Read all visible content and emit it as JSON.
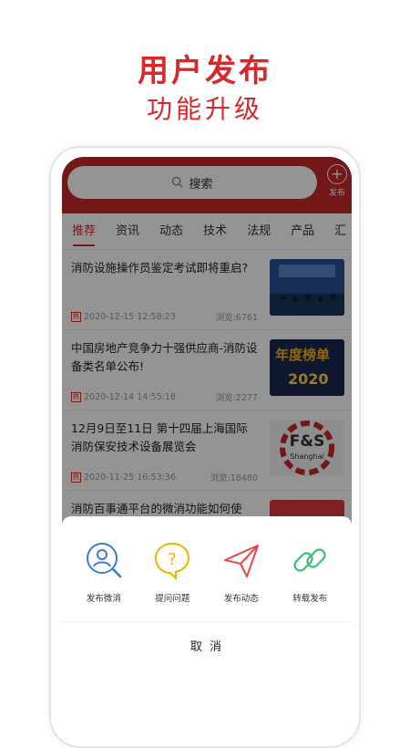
{
  "promo": {
    "title": "用户发布",
    "subtitle": "功能升级"
  },
  "header": {
    "search_placeholder": "搜索",
    "publish_label": "发布",
    "accent_color": "#c9292c"
  },
  "tabs": [
    {
      "label": "推荐",
      "active": true
    },
    {
      "label": "资讯",
      "active": false
    },
    {
      "label": "动态",
      "active": false
    },
    {
      "label": "技术",
      "active": false
    },
    {
      "label": "法规",
      "active": false
    },
    {
      "label": "产品",
      "active": false
    },
    {
      "label": "汇",
      "active": false
    }
  ],
  "news": [
    {
      "title": "消防设施操作员鉴定考试即将重启?",
      "date": "2020-12-15 12:58:23",
      "views": "浏览:6761",
      "badge": "热"
    },
    {
      "title": "中国房地产竞争力十强供应商-消防设备类名单公布!",
      "date": "2020-12-14 14:55:18",
      "views": "浏览:2277",
      "badge": "热",
      "thumb_text": "年度榜单",
      "thumb_year": "2020"
    },
    {
      "title": "12月9日至11日 第十四届上海国际消防保安技术设备展览会",
      "date": "2020-11-25 16:53:36",
      "views": "浏览:18480",
      "badge": "热",
      "thumb_text": "F&S",
      "thumb_sub": "Shanghai"
    },
    {
      "title": "消防百事通平台的微消功能如何使用?",
      "date": "",
      "views": "",
      "badge": ""
    }
  ],
  "sheet": {
    "actions": [
      {
        "label": "发布微消",
        "icon": "user-search-icon",
        "color": "#3a7bd5"
      },
      {
        "label": "提问问题",
        "icon": "question-bubble-icon",
        "color": "#f0b400"
      },
      {
        "label": "发布动态",
        "icon": "paper-plane-icon",
        "color": "#e8474a"
      },
      {
        "label": "转载发布",
        "icon": "link-icon",
        "color": "#3cbf7a"
      }
    ],
    "cancel_label": "取 消"
  }
}
